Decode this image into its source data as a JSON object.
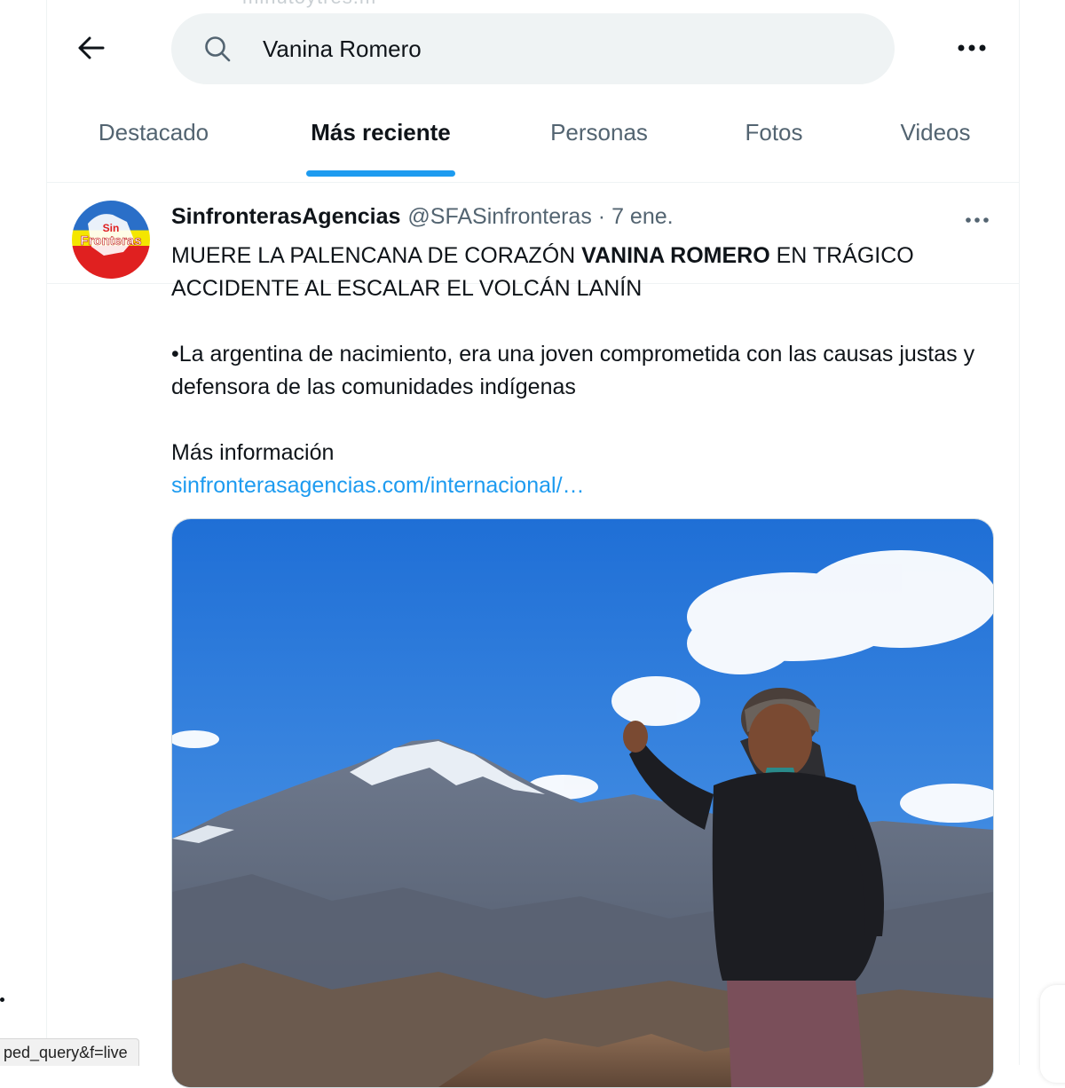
{
  "header": {
    "ghost_text": "minutoytres.m",
    "search": {
      "value": "Vanina Romero",
      "icon": "search-icon"
    },
    "back_icon": "arrow-left-icon",
    "more_icon": "more-horizontal-icon"
  },
  "tabs": [
    {
      "label": "Destacado",
      "active": false
    },
    {
      "label": "Más reciente",
      "active": true
    },
    {
      "label": "Personas",
      "active": false
    },
    {
      "label": "Fotos",
      "active": false
    },
    {
      "label": "Videos",
      "active": false
    }
  ],
  "tweet": {
    "author_name": "SinfronterasAgencias",
    "author_handle": "@SFASinfronteras",
    "separator": "·",
    "date": "7 ene.",
    "avatar_text": "Sin Fronteras",
    "text": {
      "line1_pre": "MUERE LA PALENCANA DE CORAZÓN ",
      "line1_bold": "VANINA ROMERO",
      "line1_post": " EN TRÁGICO ACCIDENTE AL ESCALAR EL VOLCÁN LANÍN",
      "para2": "•La argentina de nacimiento, era una joven comprometida con las causas justas y defensora de las comunidades indígenas",
      "para3": "Más información",
      "link": "sinfronterasagencias.com/internacional/…"
    },
    "media_alt": "Mujer con gorro y chaqueta negra haciendo el signo de la paz frente a una montaña nevada"
  },
  "status_bar": {
    "url_fragment": "ped_query&f=live"
  },
  "colors": {
    "accent": "#1d9bf0",
    "text_primary": "#0f1419",
    "text_secondary": "#536471",
    "search_bg": "#eff3f4"
  }
}
